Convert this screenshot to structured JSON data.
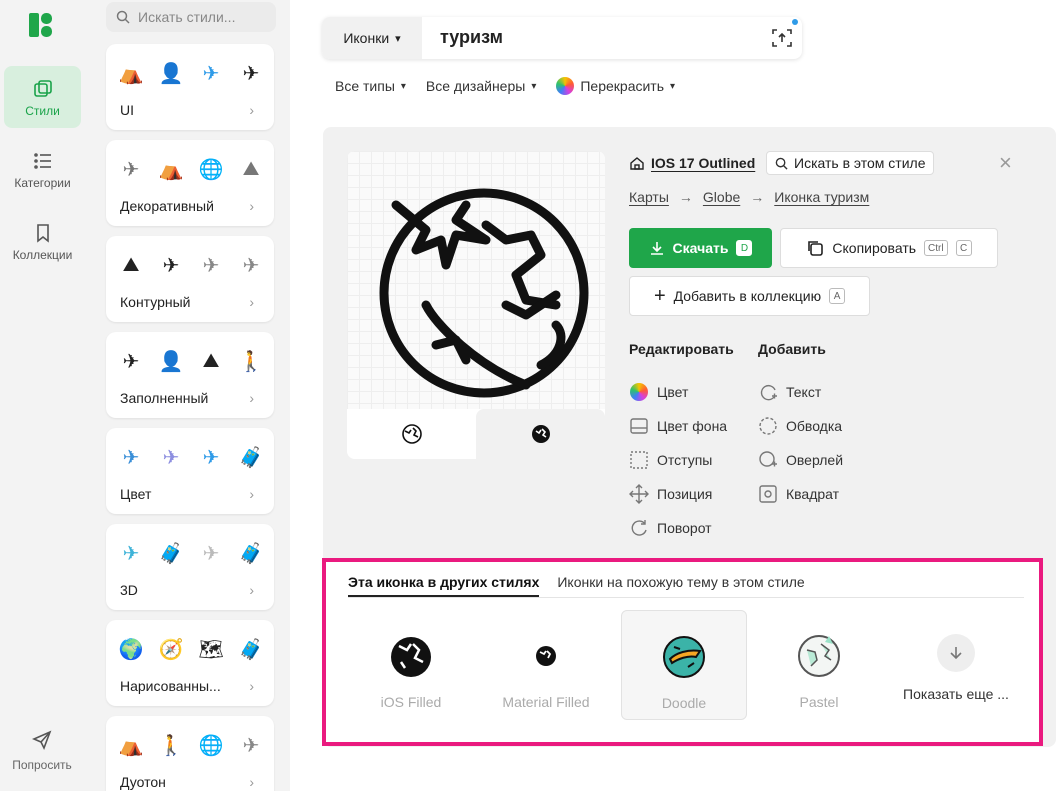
{
  "rail": {
    "items": [
      {
        "label": "Стили",
        "icon": "styles-icon"
      },
      {
        "label": "Категории",
        "icon": "categories-icon"
      },
      {
        "label": "Коллекции",
        "icon": "bookmark-icon"
      }
    ],
    "feedback_label": "Попросить"
  },
  "styles": {
    "search_placeholder": "Искать стили...",
    "cards": [
      {
        "label": "UI"
      },
      {
        "label": "Декоративный"
      },
      {
        "label": "Контурный"
      },
      {
        "label": "Заполненный"
      },
      {
        "label": "Цвет"
      },
      {
        "label": "3D"
      },
      {
        "label": "Нарисованны..."
      },
      {
        "label": "Дуотон"
      }
    ]
  },
  "search": {
    "type_label": "Иконки",
    "query": "туризм"
  },
  "filters": {
    "types": "Все типы",
    "designers": "Все дизайнеры",
    "recolor": "Перекрасить"
  },
  "detail": {
    "style_name": "IOS 17 Outlined",
    "style_search": "Искать в этом стиле",
    "crumbs": [
      "Карты",
      "Globe",
      "Иконка туризм"
    ],
    "download_label": "Скачать",
    "download_key": "D",
    "copy_label": "Скопировать",
    "copy_key_1": "Ctrl",
    "copy_key_2": "C",
    "collection_label": "Добавить в коллекцию",
    "collection_key": "A",
    "edit_title": "Редактировать",
    "add_title": "Добавить",
    "edit_options": [
      "Цвет",
      "Цвет фона",
      "Отступы",
      "Позиция",
      "Поворот"
    ],
    "add_options": [
      "Текст",
      "Обводка",
      "Оверлей",
      "Квадрат"
    ]
  },
  "others": {
    "tab_active": "Эта иконка в других стилях",
    "tab_other": "Иконки на похожую тему в этом стиле",
    "items": [
      {
        "label": "iOS Filled"
      },
      {
        "label": "Material Filled"
      },
      {
        "label": "Doodle"
      },
      {
        "label": "Pastel"
      }
    ],
    "show_more": "Показать еще ..."
  },
  "colors": {
    "brand_green": "#1fa64a",
    "highlight_pink": "#ea1a7f"
  }
}
